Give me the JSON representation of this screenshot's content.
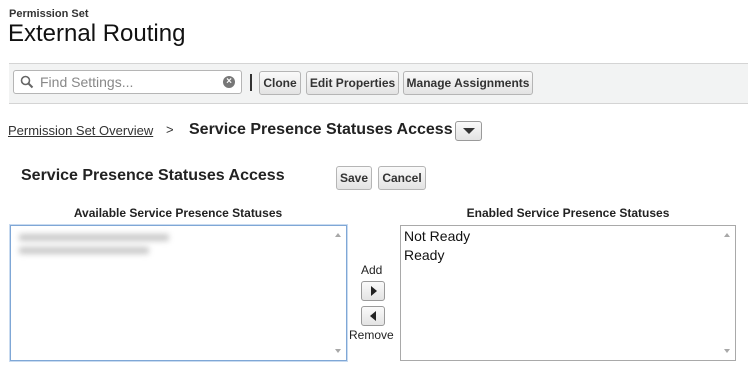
{
  "header": {
    "eyebrow": "Permission Set",
    "title": "External Routing"
  },
  "toolbar": {
    "search": {
      "placeholder": "Find Settings...",
      "value": "",
      "icon": "search-icon",
      "clear_icon": "clear-icon"
    },
    "buttons": {
      "clone": "Clone",
      "edit_properties": "Edit Properties",
      "manage_assignments": "Manage Assignments"
    }
  },
  "breadcrumb": {
    "link": "Permission Set Overview",
    "separator": ">",
    "current": "Service Presence Statuses Access",
    "dropdown_icon": "chevron-down-icon"
  },
  "section": {
    "title": "Service Presence Statuses Access",
    "save": "Save",
    "cancel": "Cancel"
  },
  "available": {
    "heading": "Available Service Presence Statuses",
    "items": []
  },
  "mover": {
    "add": "Add",
    "remove": "Remove"
  },
  "enabled": {
    "heading": "Enabled Service Presence Statuses",
    "items": [
      "Not Ready",
      "Ready"
    ]
  }
}
